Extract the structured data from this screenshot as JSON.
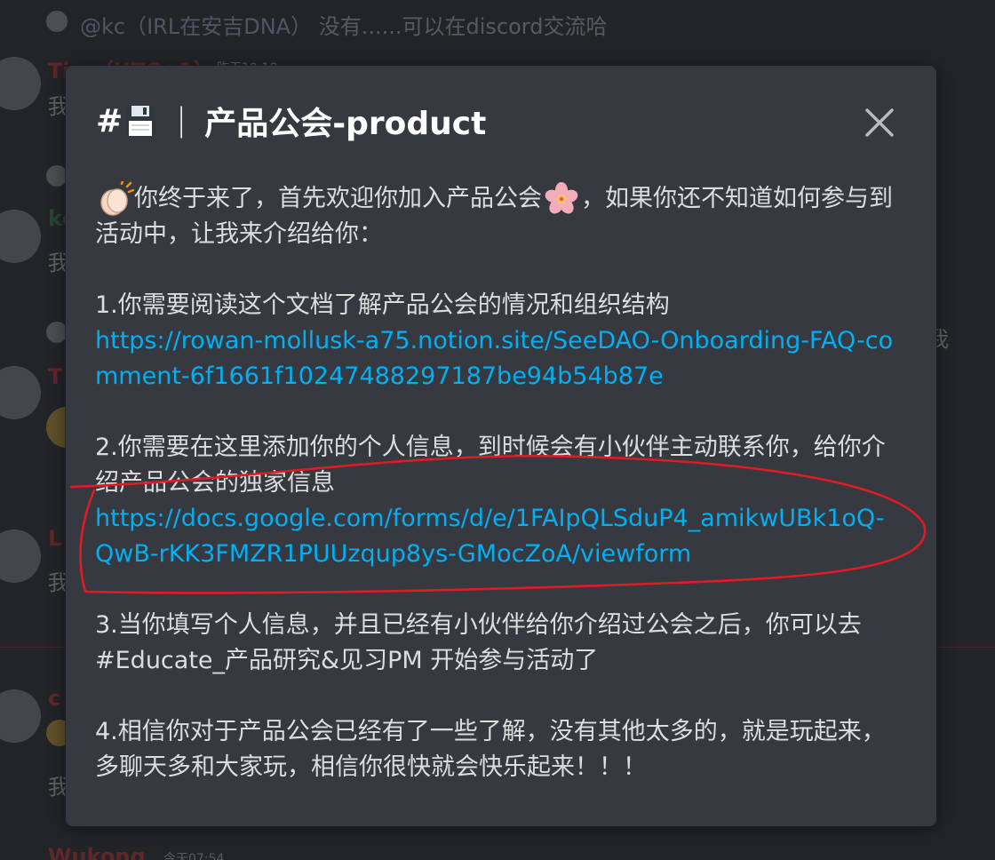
{
  "background_chat": {
    "reply_author": "@kc（IRL在安吉DNA）",
    "reply_text": "没有......可以在discord交流哈",
    "messages": [
      {
        "author": "Tim（UTC+1）",
        "time": "昨天19:18",
        "text": "我"
      },
      {
        "author": "kc",
        "text": "我"
      },
      {
        "author": "T",
        "text": "我"
      },
      {
        "author": "L",
        "text": "我"
      },
      {
        "author": "c",
        "text": "我"
      },
      {
        "author": "Wukong",
        "time": "今天07:54"
      }
    ],
    "overflow_char": "我"
  },
  "modal": {
    "title_hash": "#",
    "title_icon": "floppy-disk-icon",
    "title_divider": "｜",
    "title_text": "产品公会-product",
    "close_icon": "close-icon",
    "intro_pre": "你终于来了，首先欢迎你加入产品公会",
    "intro_post": "，如果你还不知道如何参与到活动中，让我来介绍给你：",
    "intro_emoji_1": "clapping-hands-icon",
    "intro_emoji_2": "cherry-blossom-icon",
    "step1_text": "1.你需要阅读这个文档了解产品公会的情况和组织结构",
    "step1_link": "https://rowan-mollusk-a75.notion.site/SeeDAO-Onboarding-FAQ-comment-6f1661f10247488297187be94b54b87e",
    "step2_text": "2.你需要在这里添加你的个人信息，到时候会有小伙伴主动联系你，给你介绍产品公会的独家信息",
    "step2_link": "https://docs.google.com/forms/d/e/1FAIpQLSduP4_amikwUBk1oQ-QwB-rKK3FMZR1PUUzqup8ys-GMocZoA/viewform",
    "step3_text": "3.当你填写个人信息，并且已经有小伙伴给你介绍过公会之后，你可以去 #Educate_产品研究&见习PM 开始参与活动了",
    "step4_text": "4.相信你对于产品公会已经有了一些了解，没有其他太多的，就是玩起来，多聊天多和大家玩，相信你很快就会快乐起来！！！"
  },
  "colors": {
    "modal_bg": "#36393f",
    "link": "#00aff4",
    "text": "#dcddde",
    "title": "#ffffff",
    "annotation_red": "#e01b24",
    "author_red": "#ed4245",
    "author_green": "#3ba55c"
  }
}
